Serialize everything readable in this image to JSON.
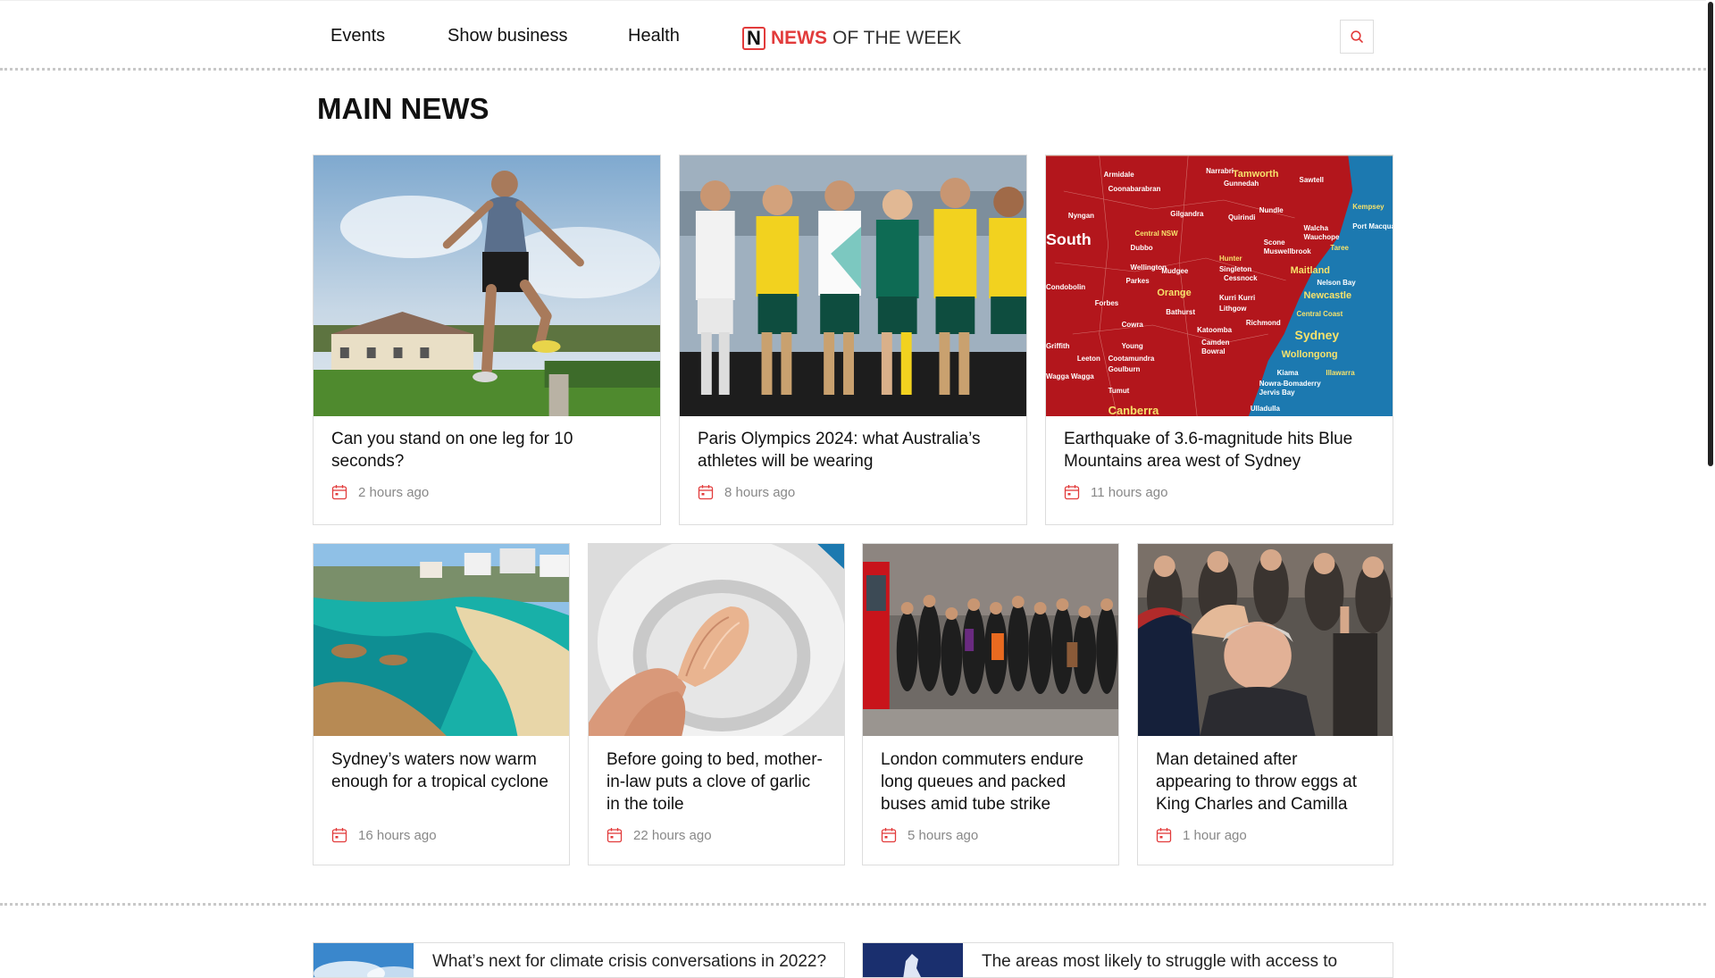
{
  "nav": {
    "items": [
      {
        "label": "Events"
      },
      {
        "label": "Show business"
      },
      {
        "label": "Health"
      }
    ]
  },
  "logo": {
    "mark": "N",
    "red": "NEWS",
    "rest": "OF THE WEEK"
  },
  "main": {
    "title": "MAIN NEWS",
    "top_row": [
      {
        "title": "Can you stand on one leg for 10 seconds?",
        "time": "2 hours ago"
      },
      {
        "title": "Paris Olympics 2024: what Australia’s athletes will be wearing",
        "time": "8 hours ago"
      },
      {
        "title": "Earthquake of 3.6-magnitude hits Blue Mountains area west of Sydney",
        "time": "11 hours ago"
      }
    ],
    "bottom_row": [
      {
        "title": "Sydney’s waters now warm enough for a tropical cyclone",
        "time": "16 hours ago"
      },
      {
        "title": "Before going to bed, mother-in-law puts a clove of garlic in the toile",
        "time": "22 hours ago"
      },
      {
        "title": "London commuters endure long queues and packed buses amid tube strike",
        "time": "5 hours ago"
      },
      {
        "title": "Man detained after appearing to throw eggs at King Charles and Camilla",
        "time": "1 hour ago"
      }
    ]
  },
  "more": [
    {
      "title": "What’s next for climate crisis conversations in 2022?"
    },
    {
      "title": "The areas most likely to struggle with access to"
    }
  ],
  "map_labels": [
    "Armidale",
    "Tamworth",
    "Sawtell",
    "Gunnedah",
    "Coonabarabran",
    "Narrabri",
    "Nyngan",
    "Gilgandra",
    "Quirindi",
    "Nundle",
    "Kempsey",
    "Port Macquarie",
    "South",
    "Central NSW",
    "Dubbo",
    "Wellington",
    "Mudgee",
    "Scone",
    "Muswellbrook",
    "Walcha",
    "Wauchope",
    "Taree",
    "Hunter",
    "Singleton",
    "Cessnock",
    "Maitland",
    "Newcastle",
    "Nelson Bay",
    "Condobolin",
    "Parkes",
    "Orange",
    "Forbes",
    "Bathurst",
    "Lithgow",
    "Kurri Kurri",
    "Central Coast",
    "Richmond",
    "Cowra",
    "Katoomba",
    "Sydney",
    "Camden",
    "Young",
    "Bowral",
    "Wollongong",
    "Griffith",
    "Leeton",
    "Cootamundra",
    "Goulburn",
    "Kiama",
    "Illawarra",
    "Nowra-Bomaderry",
    "Jervis Bay",
    "Wagga Wagga",
    "Tumut",
    "Canberra",
    "Ulladulla"
  ],
  "colors": {
    "accent": "#e23b3b",
    "border": "#dddddd",
    "meta": "#888888"
  },
  "icons": {
    "search": "search-icon",
    "calendar": "calendar-icon"
  }
}
